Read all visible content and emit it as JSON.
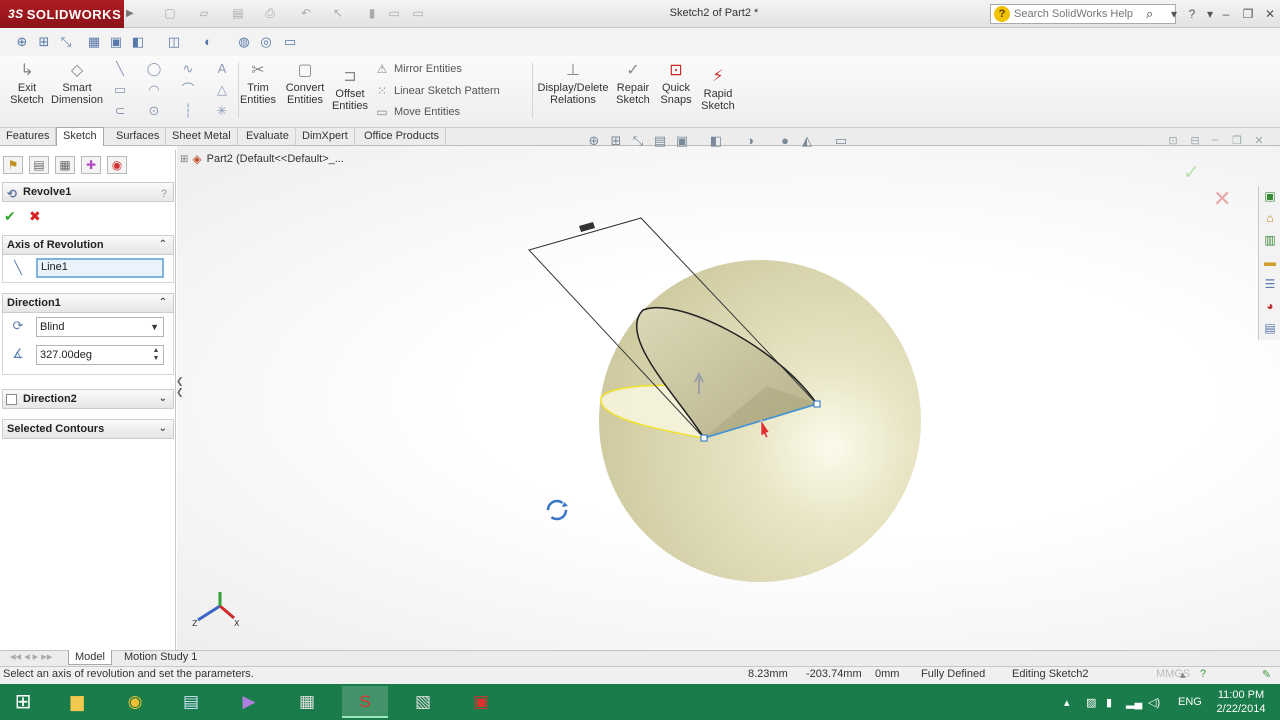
{
  "app": {
    "brand": "SOLIDWORKS",
    "brand_prefix": "3S",
    "document_title": "Sketch2 of Part2 *",
    "search_placeholder": "Search SolidWorks Help"
  },
  "command_manager": {
    "exit_sketch": [
      "Exit",
      "Sketch"
    ],
    "smart_dimension": [
      "Smart",
      "Dimension"
    ],
    "trim_entities": [
      "Trim",
      "Entities"
    ],
    "convert_entities": [
      "Convert",
      "Entities"
    ],
    "offset_entities": [
      "Offset",
      "Entities"
    ],
    "mirror_entities": "Mirror Entities",
    "linear_sketch_pattern": "Linear Sketch Pattern",
    "move_entities": "Move Entities",
    "display_delete_relations": [
      "Display/Delete",
      "Relations"
    ],
    "repair_sketch": [
      "Repair",
      "Sketch"
    ],
    "quick_snaps": [
      "Quick",
      "Snaps"
    ],
    "rapid_sketch": [
      "Rapid",
      "Sketch"
    ]
  },
  "tabs": [
    "Features",
    "Sketch",
    "Surfaces",
    "Sheet Metal",
    "Evaluate",
    "DimXpert",
    "Office Products"
  ],
  "active_tab": "Sketch",
  "property_manager": {
    "title": "Revolve1",
    "help": "?",
    "axis_of_revolution": {
      "label": "Axis of Revolution",
      "value": "Line1"
    },
    "direction1": {
      "label": "Direction1",
      "end_condition": "Blind",
      "angle": "327.00deg"
    },
    "direction2": {
      "label": "Direction2"
    },
    "selected_contours": {
      "label": "Selected Contours"
    }
  },
  "tree": {
    "root": "Part2  (Default<<Default>_..."
  },
  "bottom_tabs": [
    "Model",
    "Motion Study 1"
  ],
  "status": {
    "message": "Select an axis of revolution and set the parameters.",
    "x": "8.23mm",
    "y": "-203.74mm",
    "z": "0mm",
    "sketch_state": "Fully Defined",
    "editing": "Editing Sketch2",
    "units": "MMGS"
  },
  "taskbar": {
    "language": "ENG",
    "time": "11:00 PM",
    "date": "2/22/2014"
  },
  "colors": {
    "brand_red": "#b01d24",
    "sphere": "#e4e1b8",
    "taskbar": "#1a7c4a"
  }
}
